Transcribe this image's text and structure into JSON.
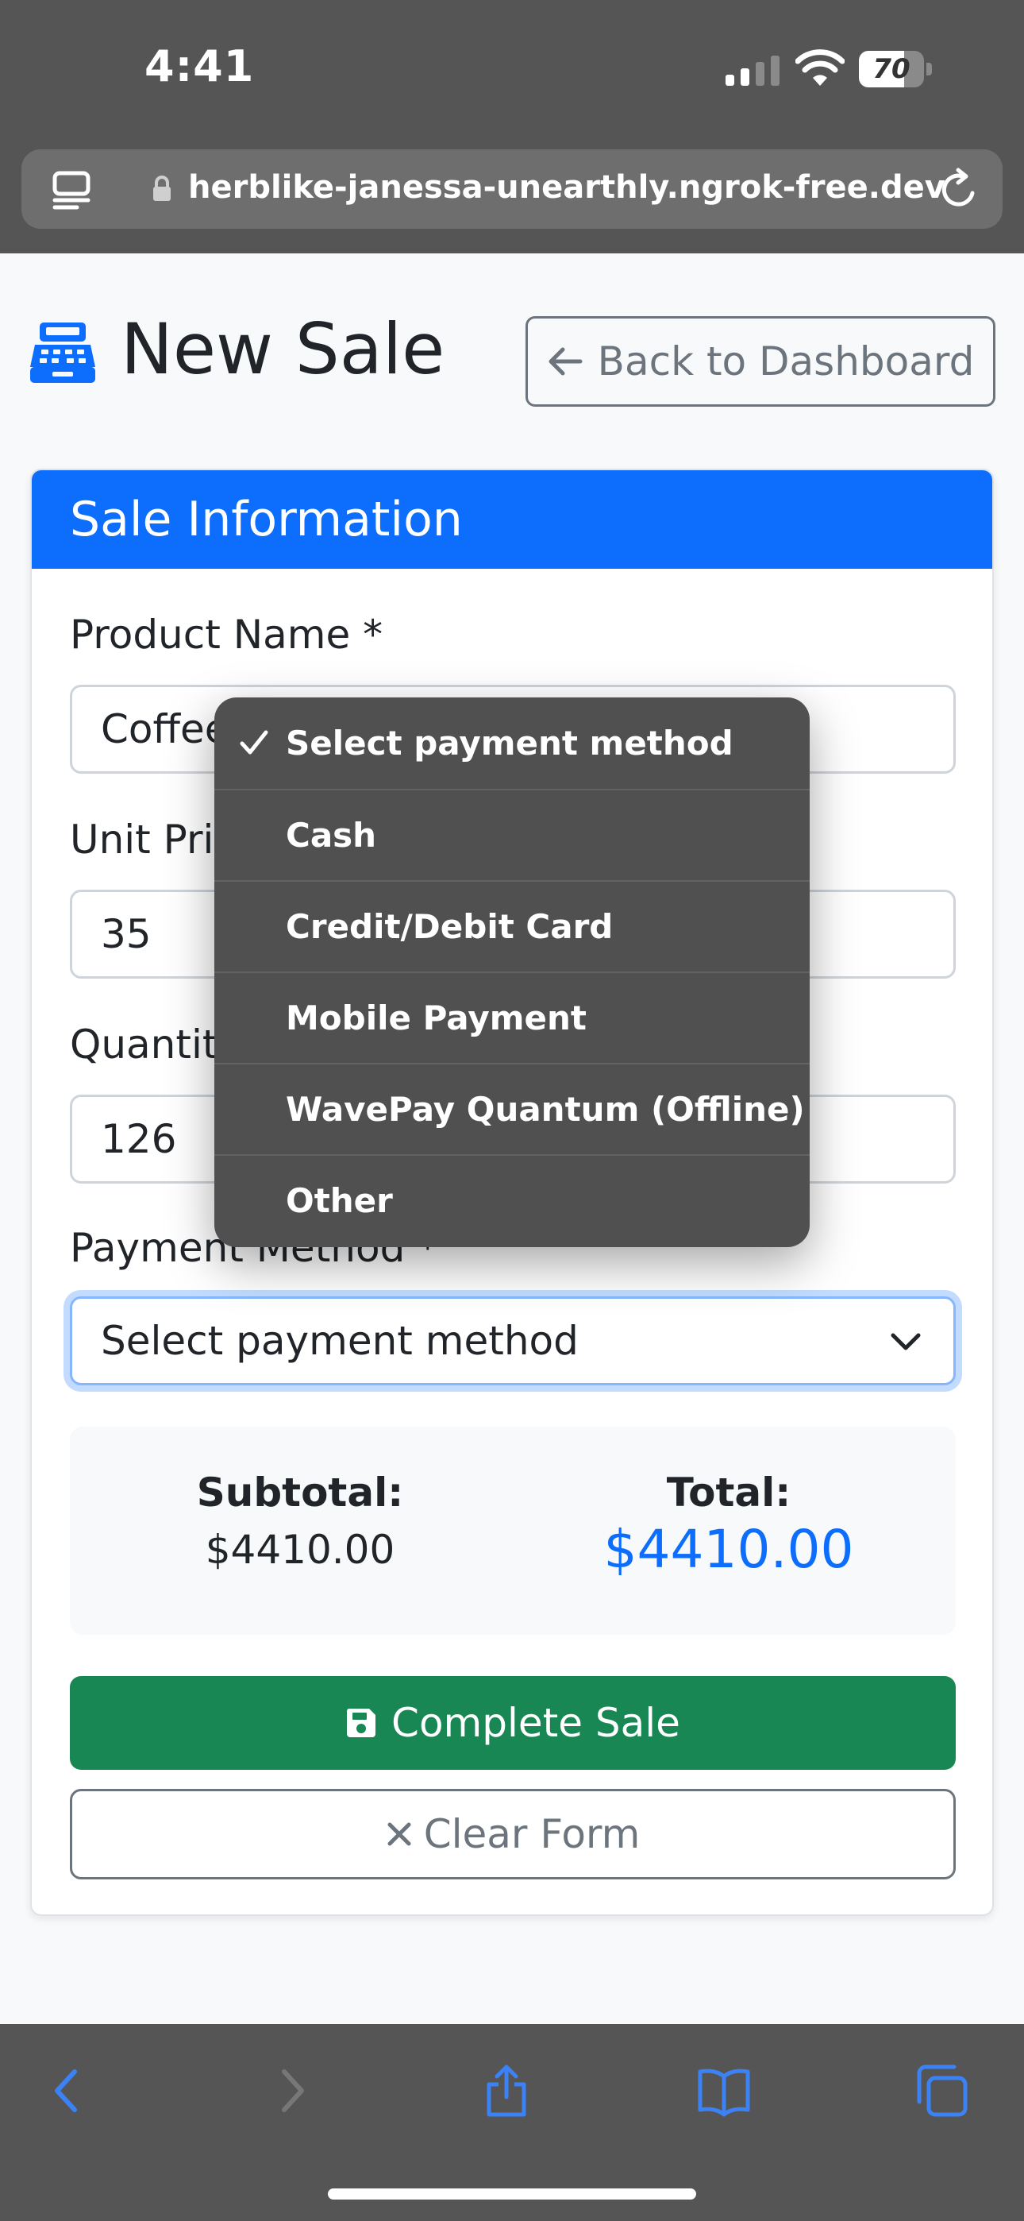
{
  "status_bar": {
    "time": "4:41",
    "battery": "70",
    "battery_level": 0.7
  },
  "browser": {
    "url": "herblike-janessa-unearthly.ngrok-free.dev"
  },
  "header": {
    "title": "New Sale",
    "back_label": "Back to Dashboard"
  },
  "card": {
    "title": "Sale Information",
    "fields": {
      "product": {
        "label": "Product Name *",
        "value": "Coffee"
      },
      "unit_price": {
        "label": "Unit Price",
        "value": "35"
      },
      "quantity": {
        "label": "Quantity",
        "value": "126"
      },
      "payment": {
        "label": "Payment Method *",
        "value": "Select payment method"
      }
    },
    "totals": {
      "subtotal_label": "Subtotal:",
      "subtotal_value": "$4410.00",
      "total_label": "Total:",
      "total_value": "$4410.00"
    },
    "complete_label": "Complete Sale",
    "clear_label": "Clear Form"
  },
  "dropdown": {
    "options": [
      "Select payment method",
      "Cash",
      "Credit/Debit Card",
      "Mobile Payment",
      "WavePay Quantum (Offline)",
      "Other"
    ],
    "selected_index": 0
  },
  "colors": {
    "primary": "#0d6efd",
    "success": "#198754",
    "secondary": "#6c757d",
    "chrome": "#555555",
    "toolbar_icon": "#3b82f6"
  }
}
